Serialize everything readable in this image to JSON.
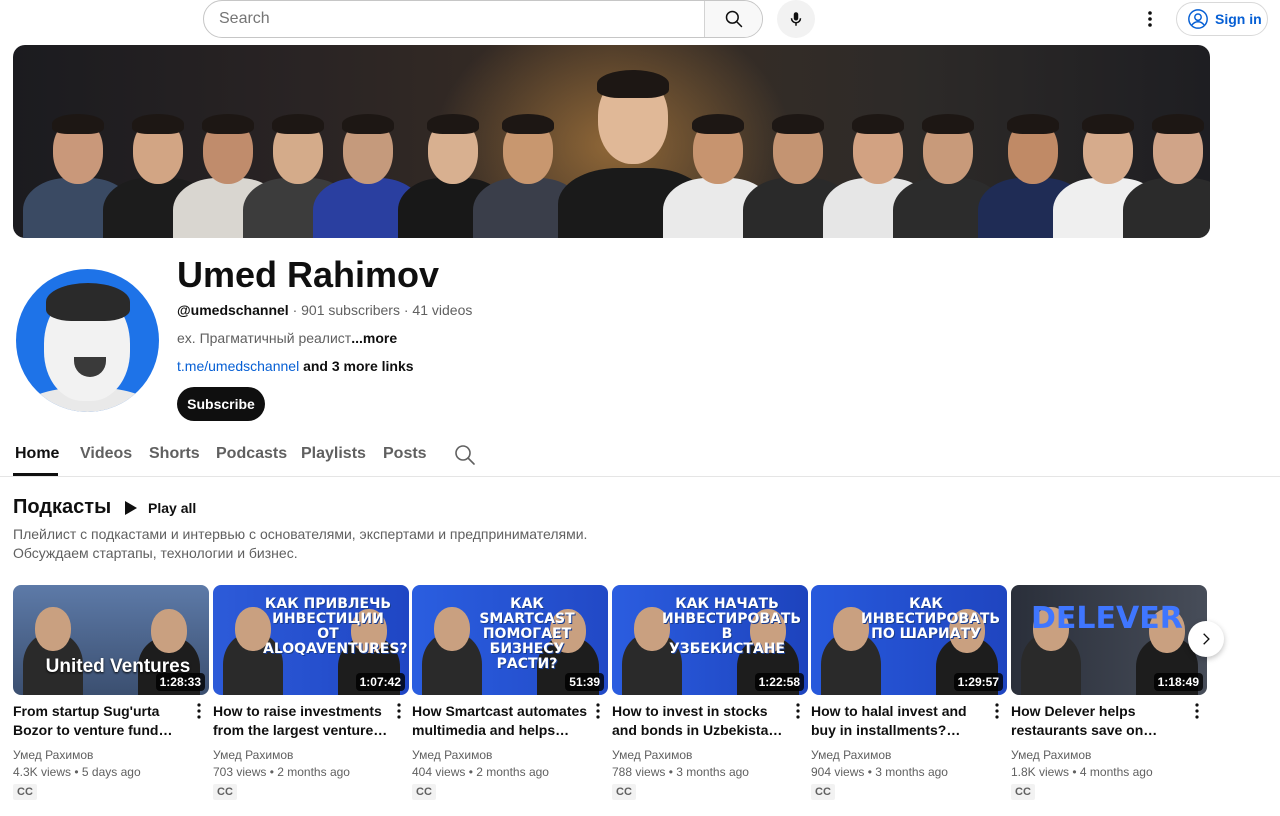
{
  "search": {
    "placeholder": "Search"
  },
  "header": {
    "sign_in_label": "Sign in"
  },
  "channel": {
    "name": "Umed Rahimov",
    "handle": "@umedschannel",
    "subscribers": "901 subscribers",
    "videos_count": "41 videos",
    "separator": " · ",
    "description": "ex. Прагматичный реалист",
    "more_label": "...more",
    "link": "t.me/umedschannel",
    "more_links": " and 3 more links",
    "subscribe_label": "Subscribe"
  },
  "tabs": [
    {
      "label": "Home",
      "active": true
    },
    {
      "label": "Videos"
    },
    {
      "label": "Shorts"
    },
    {
      "label": "Podcasts"
    },
    {
      "label": "Playlists"
    },
    {
      "label": "Posts"
    }
  ],
  "section": {
    "title": "Подкасты",
    "play_all_label": "Play all",
    "description_line1": "Плейлист с подкастами и интервью с основателями, экспертами и предпринимателями.",
    "description_line2": "Обсуждаем стартапы, технологии и бизнес."
  },
  "videos": [
    {
      "title": "From startup Sug'urta Bozor to venture fund United Ventures",
      "thumb_text": "United Ventures",
      "duration": "1:28:33",
      "author": "Умед Рахимов",
      "views": "4.3K views",
      "age": "5 days ago",
      "badge": "CC"
    },
    {
      "title": "How to raise investments from the largest venture fund",
      "thumb_text": "Как привлечь инвестиции от Aloqaventures?",
      "duration": "1:07:42",
      "author": "Умед Рахимов",
      "views": "703 views",
      "age": "2 months ago",
      "badge": "CC"
    },
    {
      "title": "How Smartcast automates multimedia and helps business grow",
      "thumb_text": "Как Smartcast помогает бизнесу расти?",
      "duration": "51:39",
      "author": "Умед Рахимов",
      "views": "404 views",
      "age": "2 months ago",
      "badge": "CC"
    },
    {
      "title": "How to invest in stocks and bonds in Uzbekistan. History",
      "thumb_text": "Как начать инвестировать в Узбекистане",
      "duration": "1:22:58",
      "author": "Умед Рахимов",
      "views": "788 views",
      "age": "3 months ago",
      "badge": "CC"
    },
    {
      "title": "How to halal invest and buy in installments? About IMAN",
      "thumb_text": "Как инвестировать по шариату",
      "duration": "1:29:57",
      "author": "Умед Рахимов",
      "views": "904 views",
      "age": "3 months ago",
      "badge": "CC"
    },
    {
      "title": "How Delever helps restaurants save on delivery",
      "thumb_text": "Delever",
      "duration": "1:18:49",
      "author": "Умед Рахимов",
      "views": "1.8K views",
      "age": "4 months ago",
      "badge": "CC"
    }
  ],
  "icons": {
    "search": "search-icon",
    "mic": "mic-icon",
    "more": "more-vert-icon",
    "account": "account-circle-icon",
    "play": "play-icon",
    "next": "chevron-right-icon"
  },
  "colors": {
    "link": "#065fd4",
    "subscribe_bg": "#0f0f0f",
    "avatar_bg": "#1e73e8",
    "thumb_blue": "#2456d6"
  }
}
